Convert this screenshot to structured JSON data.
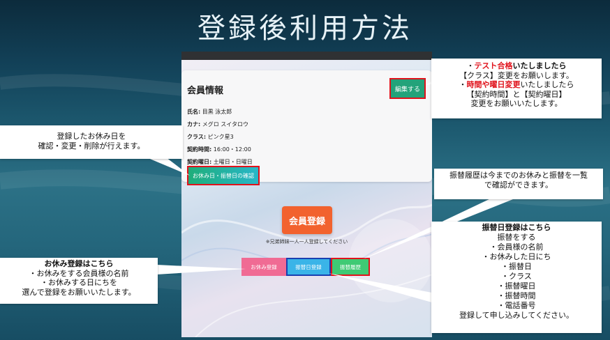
{
  "slide": {
    "title": "登録後利用方法"
  },
  "phone": {
    "card": {
      "title": "会員情報",
      "edit_button": "編集する",
      "fields": [
        {
          "label": "氏名:",
          "value": "目黒 泳太郎"
        },
        {
          "label": "カナ:",
          "value": "メグロ スイタロウ"
        },
        {
          "label": "クラス:",
          "value": "ピンク星3"
        },
        {
          "label": "契約時間:",
          "value": "16:00・12:00"
        },
        {
          "label": "契約曜日:",
          "value": "土曜日・日曜日"
        }
      ],
      "holiday_button": "お休み日・振替日の確認"
    },
    "register_button": "会員登録",
    "register_note": "※兄弟姉妹一人一人登録してください",
    "buttons": {
      "absence": "お休み登録",
      "transfer": "振替日登録",
      "history": "振替履歴"
    }
  },
  "callouts": {
    "edit": {
      "line1_prefix": "・",
      "line1_red": "テスト合格",
      "line1_suffix": "いたしましたら",
      "line2": "【クラス】変更をお願いします。",
      "line3_prefix": "・",
      "line3_red": "時間や曜日変更",
      "line3_suffix": "いたしましたら",
      "line4": "【契約時間】と【契約曜日】",
      "line5": "変更をお願いいたします。"
    },
    "holiday": {
      "line1": "登録したお休み日を",
      "line2": "確認・変更・削除が行えます。"
    },
    "history": {
      "line1": "振替履歴は今までのお休みと振替を一覧",
      "line2": "で確認ができます。"
    },
    "transfer": {
      "title": "振替日登録はこちら",
      "lines": [
        "振替をする",
        "・会員様の名前",
        "・お休みした日にち",
        "・振替日",
        "・クラス",
        "・振替曜日",
        "・振替時間",
        "・電話番号",
        "登録して申し込みしてください。"
      ]
    },
    "absence": {
      "title": "お休み登録はこちら",
      "line1": "・お休みをする会員様の名前",
      "line2": "・お休みする日にちを",
      "line3": "選んで登録をお願いいたします。"
    }
  },
  "colors": {
    "accent_red": "#e0121b",
    "edit_green": "#23a37a",
    "register_orange": "#f2622e",
    "absence_pink": "#f06b94",
    "transfer_blue": "#3ab4e8",
    "history_green": "#3fca74"
  }
}
